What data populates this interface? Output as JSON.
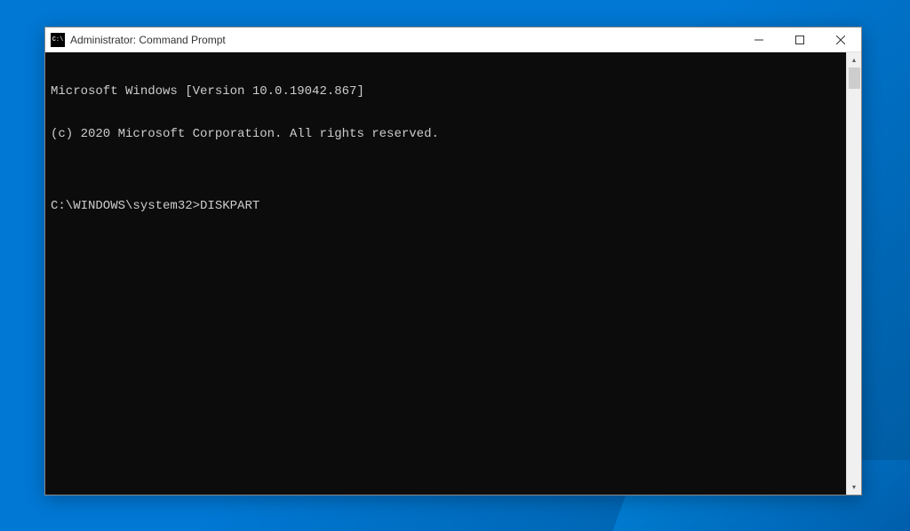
{
  "titlebar": {
    "icon_label": "C:\\",
    "title": "Administrator: Command Prompt"
  },
  "console": {
    "line1": "Microsoft Windows [Version 10.0.19042.867]",
    "line2": "(c) 2020 Microsoft Corporation. All rights reserved.",
    "blank": "",
    "prompt": "C:\\WINDOWS\\system32>",
    "command": "DISKPART"
  }
}
